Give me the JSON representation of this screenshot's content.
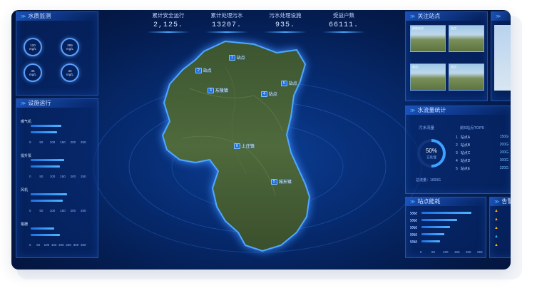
{
  "stats": [
    {
      "label": "累计安全运行",
      "value": "2,125."
    },
    {
      "label": "累计处理污水",
      "value": "13207."
    },
    {
      "label": "污水处理设施",
      "value": "935."
    },
    {
      "label": "受益户数",
      "value": "66111."
    }
  ],
  "water_quality": {
    "title": "水质监测",
    "gauges": [
      {
        "value": "120",
        "unit": "mg/L"
      },
      {
        "value": "399",
        "unit": "mg/L"
      },
      {
        "value": "36",
        "unit": "mg/L"
      },
      {
        "value": "30",
        "unit": "mg/L"
      }
    ]
  },
  "equipment": {
    "title": "设施运行",
    "sections": [
      "曝气机",
      "提升泵",
      "风机",
      "格栅"
    ],
    "axis_short": [
      "0",
      "50",
      "100",
      "150",
      "200",
      "250"
    ],
    "axis_long": [
      "0",
      "50",
      "100",
      "150",
      "200",
      "250",
      "300",
      "350"
    ]
  },
  "focus_sites": {
    "title": "关注站点",
    "photos": [
      "缺陷站点",
      "站点",
      "站点",
      "站点"
    ]
  },
  "water_stats": {
    "title": "水流量统计",
    "left_label": "污水流量",
    "donut_percent": "50%",
    "donut_sub": "已处理",
    "total_label": "总流量：1000G",
    "top_label": "前5站点TOP5",
    "rows": [
      {
        "rank": "1",
        "name": "站点A",
        "value": "150G"
      },
      {
        "rank": "2",
        "name": "站点B",
        "value": "200G"
      },
      {
        "rank": "3",
        "name": "站点C",
        "value": "200G"
      },
      {
        "rank": "4",
        "name": "站点D",
        "value": "300G"
      },
      {
        "rank": "5",
        "name": "站点E",
        "value": "320G"
      }
    ]
  },
  "site_energy": {
    "title": "站点能耗",
    "axis": [
      "0",
      "50",
      "100",
      "150",
      "200",
      "250"
    ]
  },
  "alarms": {
    "title": "告警"
  },
  "map_markers": [
    {
      "num": "1",
      "name": "站点"
    },
    {
      "num": "2",
      "name": "站点"
    },
    {
      "num": "3",
      "name": "东陵镇"
    },
    {
      "num": "4",
      "name": "站点"
    },
    {
      "num": "5",
      "name": "站点"
    },
    {
      "num": "6",
      "name": "上庄镇"
    },
    {
      "num": "5",
      "name": "城东镇"
    }
  ],
  "chart_data": {
    "type": "bar",
    "title": "设施运行",
    "sections": [
      {
        "name": "曝气机",
        "values": [
          210,
          180
        ]
      },
      {
        "name": "提升泵",
        "values": [
          230,
          200
        ]
      },
      {
        "name": "风机",
        "values": [
          250,
          220
        ]
      },
      {
        "name": "格栅",
        "values": [
          160,
          200
        ]
      }
    ]
  }
}
